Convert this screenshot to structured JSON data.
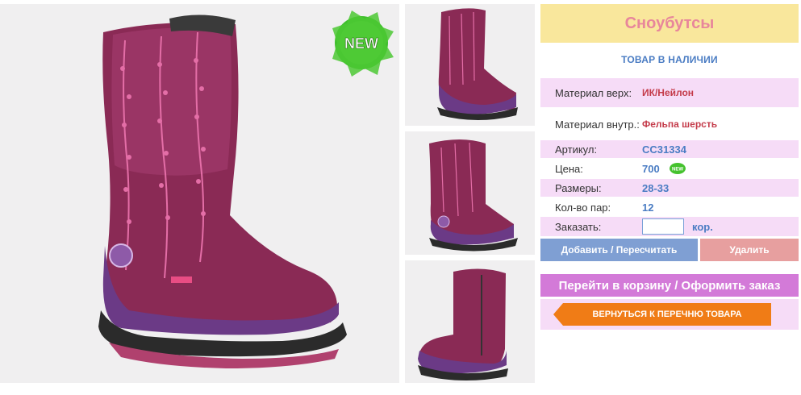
{
  "product": {
    "title": "Сноубутсы",
    "stock_status": "ТОВАР В НАЛИЧИИ",
    "new_badge": "NEW",
    "mini_new_badge": "NEW"
  },
  "specs": [
    {
      "label": "Материал верх:",
      "value": "ИК/Нейлон"
    },
    {
      "label": "Материал внутр.:",
      "value": "Фельпа шерсть"
    },
    {
      "label": "Артикул:",
      "value": "СС31334"
    },
    {
      "label": "Цена:",
      "value": "700"
    },
    {
      "label": "Размеры:",
      "value": "28-33"
    },
    {
      "label": "Кол-во пар:",
      "value": "12"
    }
  ],
  "order": {
    "label": "Заказать:",
    "quantity_value": "",
    "unit": "кор."
  },
  "buttons": {
    "add": "Добавить / Пересчитать",
    "delete": "Удалить",
    "cart": "Перейти в корзину / Оформить заказ",
    "back": "ВЕРНУТЬСЯ К ПЕРЕЧНЮ ТОВАРА"
  },
  "colors": {
    "title_bg": "#f9e79c",
    "title_text": "#e8869b",
    "accent_blue": "#4a7cc3",
    "value_red": "#c43b4a",
    "row_pink": "#f6dcf7",
    "cart_button": "#d37ad8",
    "back_button": "#f07c16",
    "add_button": "#7f9fd3",
    "delete_button": "#e79f9f"
  },
  "images": {
    "main": "boot-photo-front",
    "thumbnails": [
      "boot-photo-front-small",
      "boot-photo-angle",
      "boot-photo-side-zipper"
    ]
  }
}
